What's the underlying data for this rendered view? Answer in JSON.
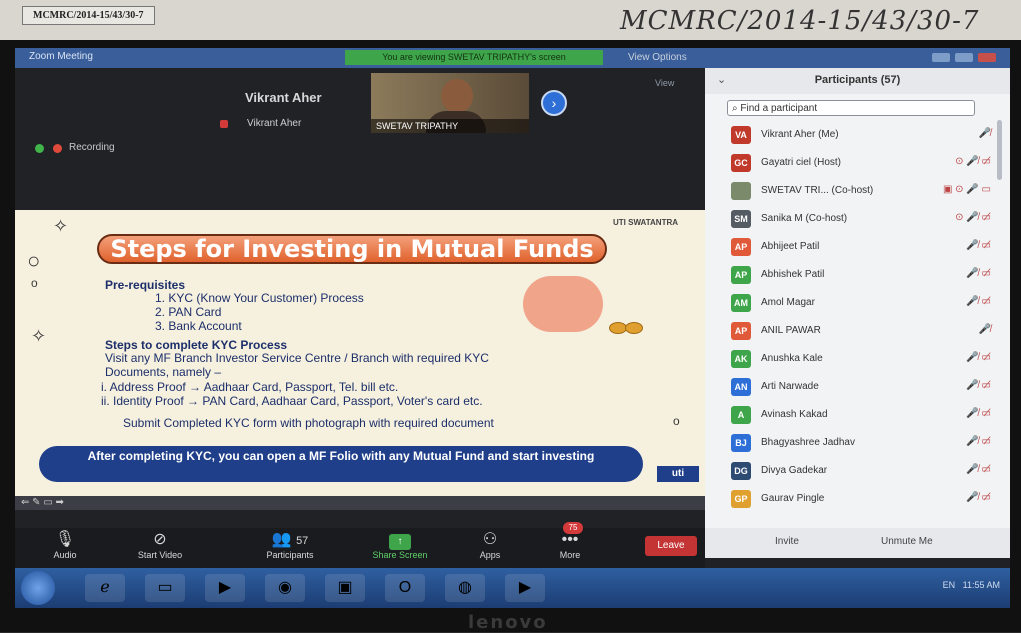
{
  "photo": {
    "stamp": "MCMRC/2014-15/43/30-7",
    "handwriting": "MCMRC/2014-15/43/30-7",
    "monitor_brand": "lenovo"
  },
  "window": {
    "title": "Zoom Meeting",
    "viewing_banner": "You are viewing SWETAV TRIPATHY's screen",
    "view_options": "View Options",
    "view_label": "View"
  },
  "stage": {
    "speaker_name": "Vikrant Aher",
    "speaker_sub": "Vikrant Aher",
    "video_label": "SWETAV TRIPATHY",
    "recording": "Recording"
  },
  "slide": {
    "brand": "UTI SWATANTRA",
    "title": "Steps for Investing in Mutual Funds",
    "prereq_heading": "Pre-requisites",
    "prereq_items": [
      "1. KYC (Know Your Customer) Process",
      "2. PAN Card",
      "3. Bank Account"
    ],
    "steps_heading": "Steps to complete KYC Process",
    "steps_line1": "Visit any MF Branch Investor Service Centre / Branch with required KYC",
    "steps_line2": "Documents, namely –",
    "proof1": "i.  Address Proof → Aadhaar Card, Passport, Tel. bill etc.",
    "proof2": "ii.  Identity Proof → PAN Card, Aadhaar Card, Passport, Voter's card etc.",
    "submit": "Submit Completed KYC form with photograph with required document",
    "footer": "After completing KYC, you can open a MF Folio with any Mutual Fund and start investing",
    "logo": "uti"
  },
  "participants": {
    "title": "Participants (57)",
    "search_placeholder": "Find a participant",
    "list": [
      {
        "initials": "VA",
        "name": "Vikrant Aher (Me)",
        "color": "#c0392b",
        "icons": "🎤̸"
      },
      {
        "initials": "GC",
        "name": "Gayatri ciel (Host)",
        "color": "#c0392b",
        "icons": "⊙ 🎤̸ ▭̸"
      },
      {
        "initials": "",
        "name": "SWETAV TRI... (Co-host)",
        "color": "#7a8a6a",
        "icons": "▣ ⊙ 🎤 ▭"
      },
      {
        "initials": "SM",
        "name": "Sanika M (Co-host)",
        "color": "#555b63",
        "icons": "⊙ 🎤̸ ▭̸"
      },
      {
        "initials": "AP",
        "name": "Abhijeet Patil",
        "color": "#e05a3a",
        "icons": "🎤̸ ▭̸"
      },
      {
        "initials": "AP",
        "name": "Abhishek Patil",
        "color": "#3fa54a",
        "icons": "🎤̸ ▭̸"
      },
      {
        "initials": "AM",
        "name": "Amol Magar",
        "color": "#3fa54a",
        "icons": "🎤̸ ▭̸"
      },
      {
        "initials": "AP",
        "name": "ANIL PAWAR",
        "color": "#e05a3a",
        "icons": "🎤̸"
      },
      {
        "initials": "AK",
        "name": "Anushka Kale",
        "color": "#3fa54a",
        "icons": "🎤̸ ▭̸"
      },
      {
        "initials": "AN",
        "name": "Arti Narwade",
        "color": "#2d6fd6",
        "icons": "🎤̸ ▭̸"
      },
      {
        "initials": "A",
        "name": "Avinash Kakad",
        "color": "#3fa54a",
        "icons": "🎤̸ ▭̸"
      },
      {
        "initials": "BJ",
        "name": "Bhagyashree Jadhav",
        "color": "#2d6fd6",
        "icons": "🎤̸ ▭̸"
      },
      {
        "initials": "DG",
        "name": "Divya Gadekar",
        "color": "#2d4a73",
        "icons": "🎤̸ ▭̸"
      },
      {
        "initials": "GP",
        "name": "Gaurav Pingle",
        "color": "#e0a030",
        "icons": "🎤̸ ▭̸"
      }
    ],
    "invite": "Invite",
    "unmute_me": "Unmute Me"
  },
  "toolbar": {
    "audio": "Audio",
    "start_video": "Start Video",
    "participants": "Participants",
    "participants_count": "57",
    "share_screen": "Share Screen",
    "apps": "Apps",
    "more": "More",
    "more_badge": "75",
    "leave": "Leave"
  },
  "taskbar": {
    "tray": "EN",
    "time": "11:55 AM"
  }
}
